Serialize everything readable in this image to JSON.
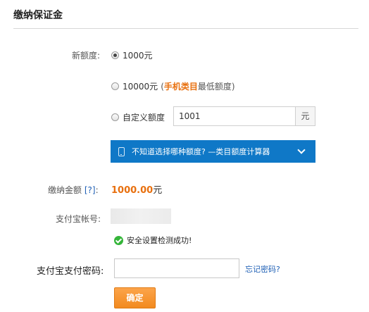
{
  "title": "缴纳保证金",
  "new_quota": {
    "label": "新额度:",
    "options": [
      {
        "text": "1000元",
        "checked": true
      },
      {
        "text": "10000元",
        "paren_open": "(",
        "highlight": "手机类目",
        "tail": "最低额度",
        "paren_close": ")",
        "checked": false
      },
      {
        "text": "自定义额度",
        "checked": false
      }
    ],
    "custom_value": "1001",
    "custom_unit": "元"
  },
  "calculator": {
    "text": "不知道选择哪种额度? —类目额度计算器",
    "icon": "phone-icon",
    "chevron": "chevron-down-icon",
    "color": "#0f78c7"
  },
  "amount": {
    "label": "缴纳金额",
    "help": "[?]",
    "colon": ":",
    "value": "1000.00",
    "unit": "元",
    "color": "#e8700f"
  },
  "alipay_account": {
    "label": "支付宝帐号:"
  },
  "security_check": {
    "text": "安全设置检测成功!",
    "icon": "check-circle-icon"
  },
  "password": {
    "label": "支付宝支付密码:",
    "value": "",
    "forgot": "忘记密码?"
  },
  "confirm": {
    "label": "确定",
    "color": "#f28a1f"
  }
}
